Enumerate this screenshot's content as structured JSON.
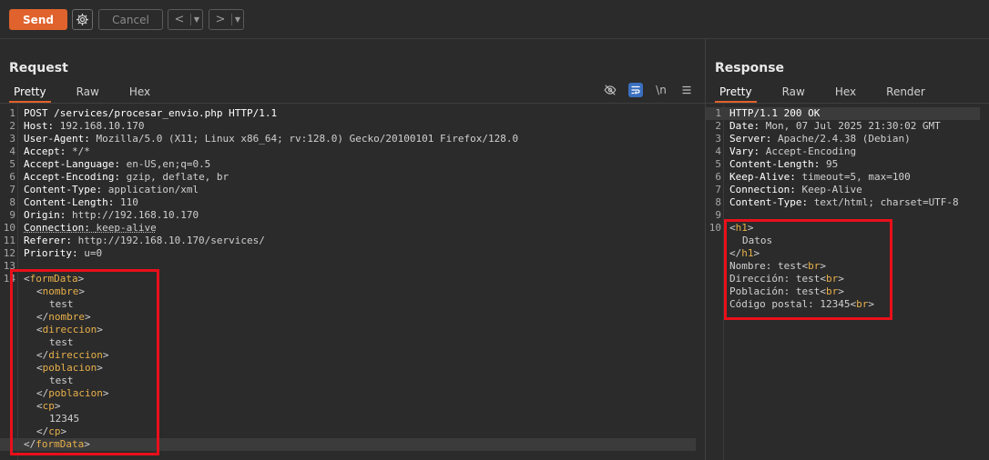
{
  "toolbar": {
    "send_label": "Send",
    "cancel_label": "Cancel",
    "back_arrow": "<",
    "forward_arrow": ">",
    "dropdown_glyph": "▼"
  },
  "request": {
    "title": "Request",
    "tabs": [
      "Pretty",
      "Raw",
      "Hex"
    ],
    "icons": [
      "hide-icon",
      "wrap-icon",
      "newline-icon",
      "menu-icon"
    ],
    "newline_label": "\\n",
    "header_lines": [
      {
        "n": "1",
        "key": "POST /services/procesar_envio.php HTTP/1.1",
        "val": ""
      },
      {
        "n": "2",
        "key": "Host",
        "val": "192.168.10.170"
      },
      {
        "n": "3",
        "key": "User-Agent",
        "val": "Mozilla/5.0 (X11; Linux x86_64; rv:128.0) Gecko/20100101 Firefox/128.0"
      },
      {
        "n": "4",
        "key": "Accept",
        "val": "*/*"
      },
      {
        "n": "5",
        "key": "Accept-Language",
        "val": "en-US,en;q=0.5"
      },
      {
        "n": "6",
        "key": "Accept-Encoding",
        "val": "gzip, deflate, br"
      },
      {
        "n": "7",
        "key": "Content-Type",
        "val": "application/xml"
      },
      {
        "n": "8",
        "key": "Content-Length",
        "val": "110"
      },
      {
        "n": "9",
        "key": "Origin",
        "val": "http://192.168.10.170"
      },
      {
        "n": "10",
        "key": "Connection",
        "val": "keep-alive"
      },
      {
        "n": "11",
        "key": "Referer",
        "val": "http://192.168.10.170/services/"
      },
      {
        "n": "12",
        "key": "Priority",
        "val": "u=0"
      },
      {
        "n": "13",
        "key": "",
        "val": ""
      }
    ],
    "body_line_number": "14",
    "body_lines": [
      {
        "indent": 0,
        "kind": "open",
        "tag": "formData"
      },
      {
        "indent": 1,
        "kind": "open",
        "tag": "nombre"
      },
      {
        "indent": 2,
        "kind": "text",
        "text": "test"
      },
      {
        "indent": 1,
        "kind": "close",
        "tag": "nombre"
      },
      {
        "indent": 1,
        "kind": "open",
        "tag": "direccion"
      },
      {
        "indent": 2,
        "kind": "text",
        "text": "test"
      },
      {
        "indent": 1,
        "kind": "close",
        "tag": "direccion"
      },
      {
        "indent": 1,
        "kind": "open",
        "tag": "poblacion"
      },
      {
        "indent": 2,
        "kind": "text",
        "text": "test"
      },
      {
        "indent": 1,
        "kind": "close",
        "tag": "poblacion"
      },
      {
        "indent": 1,
        "kind": "open",
        "tag": "cp"
      },
      {
        "indent": 2,
        "kind": "text",
        "text": "12345"
      },
      {
        "indent": 1,
        "kind": "close",
        "tag": "cp"
      },
      {
        "indent": 0,
        "kind": "close",
        "tag": "formData"
      }
    ]
  },
  "response": {
    "title": "Response",
    "tabs": [
      "Pretty",
      "Raw",
      "Hex",
      "Render"
    ],
    "header_lines": [
      {
        "n": "1",
        "key": "HTTP/1.1 200 OK",
        "val": ""
      },
      {
        "n": "2",
        "key": "Date",
        "val": "Mon, 07 Jul 2025 21:30:02 GMT"
      },
      {
        "n": "3",
        "key": "Server",
        "val": "Apache/2.4.38 (Debian)"
      },
      {
        "n": "4",
        "key": "Vary",
        "val": "Accept-Encoding"
      },
      {
        "n": "5",
        "key": "Content-Length",
        "val": "95"
      },
      {
        "n": "6",
        "key": "Keep-Alive",
        "val": "timeout=5, max=100"
      },
      {
        "n": "7",
        "key": "Connection",
        "val": "Keep-Alive"
      },
      {
        "n": "8",
        "key": "Content-Type",
        "val": "text/html; charset=UTF-8"
      },
      {
        "n": "9",
        "key": "",
        "val": ""
      }
    ],
    "body_line_number": "10",
    "body_lines": [
      {
        "indent": 0,
        "parts": [
          {
            "t": "tag",
            "s": "<h1>"
          }
        ]
      },
      {
        "indent": 1,
        "parts": [
          {
            "t": "text",
            "s": "Datos"
          }
        ]
      },
      {
        "indent": 0,
        "parts": [
          {
            "t": "tag",
            "s": "</h1>"
          }
        ]
      },
      {
        "indent": 0,
        "parts": [
          {
            "t": "text",
            "s": "Nombre: test"
          },
          {
            "t": "tag",
            "s": "<br>"
          }
        ]
      },
      {
        "indent": 0,
        "parts": [
          {
            "t": "text",
            "s": "Dirección: test"
          },
          {
            "t": "tag",
            "s": "<br>"
          }
        ]
      },
      {
        "indent": 0,
        "parts": [
          {
            "t": "text",
            "s": "Población: test"
          },
          {
            "t": "tag",
            "s": "<br>"
          }
        ]
      },
      {
        "indent": 0,
        "parts": [
          {
            "t": "text",
            "s": "Código postal: 12345"
          },
          {
            "t": "tag",
            "s": "<br>"
          }
        ]
      }
    ]
  },
  "colors": {
    "accent": "#e0622c",
    "tag": "#e8b04a",
    "highlight_box": "#e8101a",
    "wrap_active": "#3a6fbf"
  }
}
